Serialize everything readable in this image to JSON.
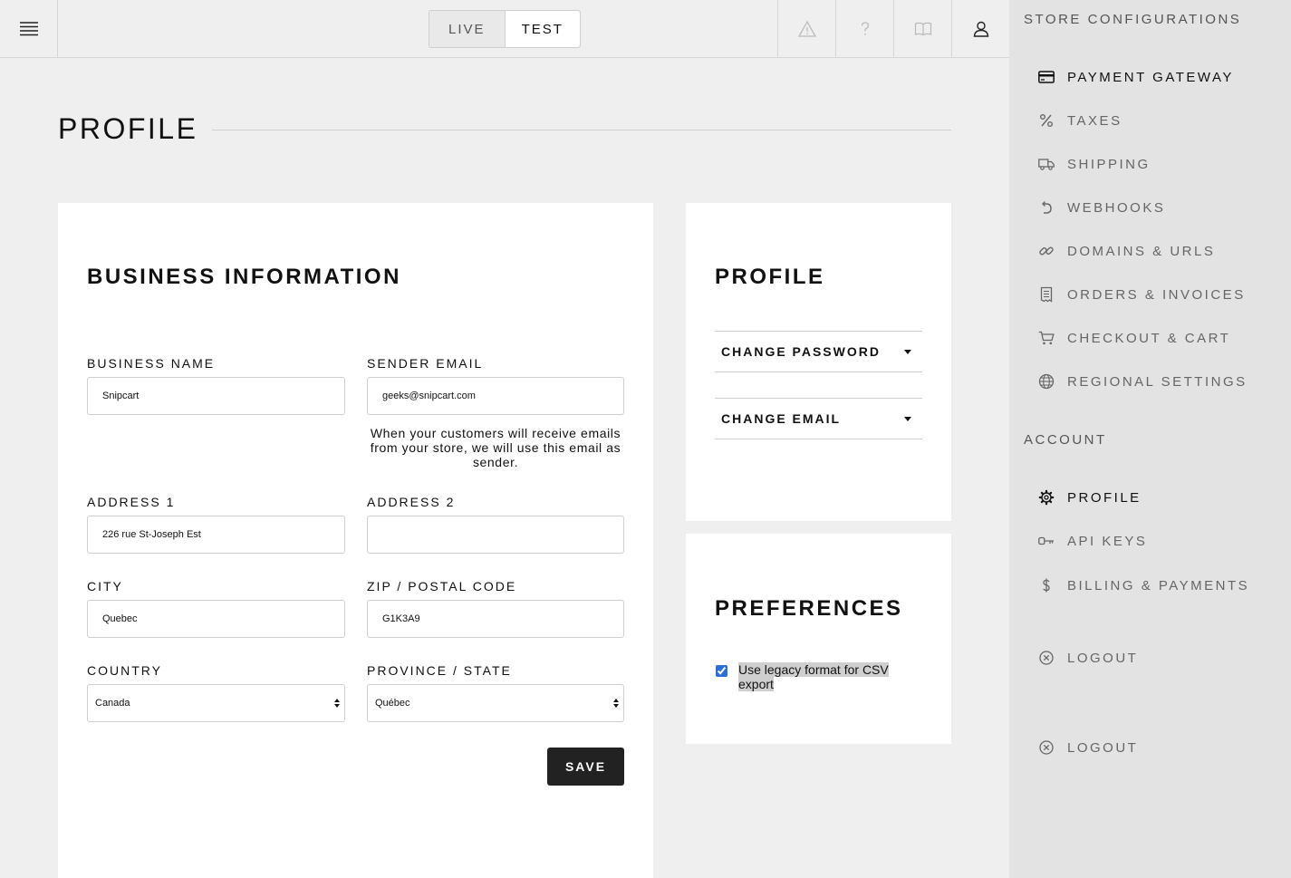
{
  "topbar": {
    "modes": [
      "LIVE",
      "TEST"
    ],
    "active_mode": "TEST",
    "icons": [
      "warning-icon",
      "help-icon",
      "docs-icon",
      "user-icon"
    ]
  },
  "page": {
    "title": "PROFILE"
  },
  "business": {
    "title": "BUSINESS INFORMATION",
    "business_name": {
      "label": "BUSINESS NAME",
      "value": "Snipcart"
    },
    "sender_email": {
      "label": "SENDER EMAIL",
      "value": "geeks@snipcart.com",
      "help": "When your customers will receive emails from your store, we will use this email as sender."
    },
    "address1": {
      "label": "ADDRESS 1",
      "value": "226 rue St-Joseph Est"
    },
    "address2": {
      "label": "ADDRESS 2",
      "value": ""
    },
    "city": {
      "label": "CITY",
      "value": "Quebec"
    },
    "zip": {
      "label": "ZIP / POSTAL CODE",
      "value": "G1K3A9"
    },
    "country": {
      "label": "COUNTRY",
      "value": "Canada"
    },
    "province": {
      "label": "PROVINCE / STATE",
      "value": "Québec"
    },
    "save_label": "SAVE"
  },
  "profile_card": {
    "title": "PROFILE",
    "change_password": "CHANGE PASSWORD",
    "change_email": "CHANGE EMAIL"
  },
  "preferences": {
    "title": "PREFERENCES",
    "legacy_csv_label": "Use legacy format for CSV export",
    "legacy_csv_checked": true
  },
  "sidebar": {
    "store_title": "STORE CONFIGURATIONS",
    "store_items": [
      {
        "label": "PAYMENT GATEWAY",
        "icon": "credit-card-icon",
        "active": true
      },
      {
        "label": "TAXES",
        "icon": "percent-icon"
      },
      {
        "label": "SHIPPING",
        "icon": "truck-icon"
      },
      {
        "label": "WEBHOOKS",
        "icon": "undo-arrow-icon"
      },
      {
        "label": "DOMAINS & URLS",
        "icon": "link-icon"
      },
      {
        "label": "ORDERS & INVOICES",
        "icon": "receipt-icon"
      },
      {
        "label": "CHECKOUT & CART",
        "icon": "cart-icon"
      },
      {
        "label": "REGIONAL SETTINGS",
        "icon": "globe-icon"
      }
    ],
    "account_title": "ACCOUNT",
    "account_items": [
      {
        "label": "PROFILE",
        "icon": "gear-icon",
        "active": true
      },
      {
        "label": "API KEYS",
        "icon": "key-icon"
      },
      {
        "label": "BILLING & PAYMENTS",
        "icon": "dollar-icon"
      }
    ],
    "logout_1": "LOGOUT",
    "logout_2": "LOGOUT"
  }
}
